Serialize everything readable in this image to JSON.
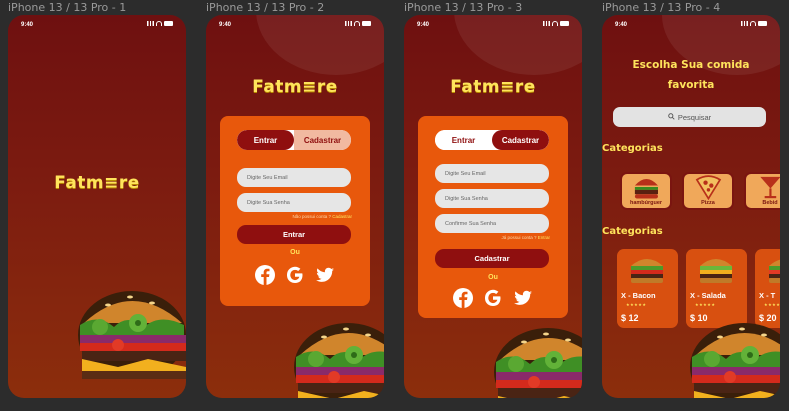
{
  "frames": [
    {
      "label": "iPhone 13 / 13 Pro - 1"
    },
    {
      "label": "iPhone 13 / 13 Pro - 2"
    },
    {
      "label": "iPhone 13 / 13 Pro - 3"
    },
    {
      "label": "iPhone 13 / 13 Pro - 4"
    }
  ],
  "status": {
    "time": "9:40"
  },
  "brand": {
    "logo": "Fatm≡re"
  },
  "login": {
    "tab_login": "Entrar",
    "tab_register": "Cadastrar",
    "email_placeholder": "Digite Seu Email",
    "password_placeholder": "Digite Sua Senha",
    "no_account": "Não possui conta ?",
    "no_account_link": "Cadastrar",
    "submit": "Entrar",
    "or": "Ou"
  },
  "register": {
    "tab_login": "Entrar",
    "tab_register": "Cadastrar",
    "email_placeholder": "Digite Seu Email",
    "password_placeholder": "Digite Sua Senha",
    "confirm_placeholder": "Confirme Sua Senha",
    "has_account": "Já possui conta ?",
    "has_account_link": "Entrar",
    "submit": "Cadastrar",
    "or": "Ou"
  },
  "home": {
    "title_line1": "Escolha Sua comida",
    "title_line2": "favorita",
    "search_placeholder": "Pesquisar",
    "categories_heading": "Categorias",
    "categories_heading2": "Categorias",
    "categories": [
      {
        "label": "hambúrguer",
        "icon": "burger-icon"
      },
      {
        "label": "Pizza",
        "icon": "pizza-icon"
      },
      {
        "label": "Bebid",
        "icon": "cocktail-icon"
      }
    ],
    "products": [
      {
        "name": "X - Bacon",
        "stars": "★★★★★",
        "price": "$ 12"
      },
      {
        "name": "X - Salada",
        "stars": "★★★★★",
        "price": "$ 10"
      },
      {
        "name": "X - T",
        "stars": "★★★★★",
        "price": "$ 20"
      }
    ]
  },
  "colors": {
    "primary": "#8f0f0f",
    "accent": "#ffe45c",
    "card": "#e8580c"
  },
  "social_icons": [
    "facebook-icon",
    "google-icon",
    "twitter-icon"
  ]
}
